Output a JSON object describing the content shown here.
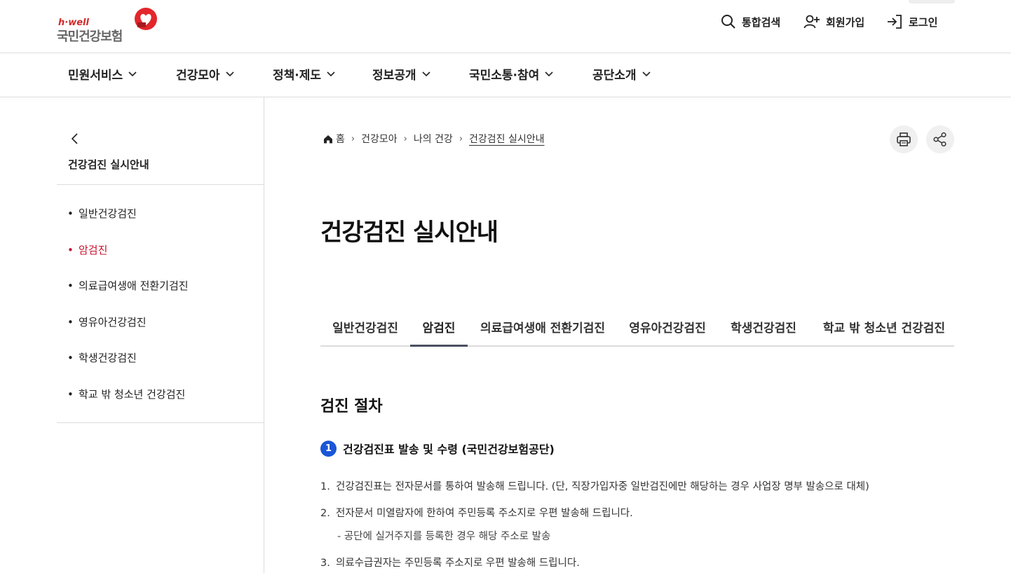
{
  "header": {
    "logo_top": "h·well",
    "logo_name": "국민건강보험",
    "utils": {
      "search": "통합검색",
      "join": "회원가입",
      "login": "로그인"
    }
  },
  "gnb": [
    "민원서비스",
    "건강모아",
    "정책·제도",
    "정보공개",
    "국민소통·참여",
    "공단소개"
  ],
  "lnb": {
    "title": "건강검진 실시안내",
    "items": [
      "일반건강검진",
      "암검진",
      "의료급여생애 전환기검진",
      "영유아건강검진",
      "학생건강검진",
      "학교 밖 청소년 건강검진"
    ],
    "active_index": 1
  },
  "breadcrumb": [
    "홈",
    "건강모아",
    "나의 건강",
    "건강검진 실시안내"
  ],
  "page_title": "건강검진 실시안내",
  "tabs": [
    "일반건강검진",
    "암검진",
    "의료급여생애 전환기검진",
    "영유아건강검진",
    "학생건강검진",
    "학교 밖 청소년 건강검진"
  ],
  "active_tab": 1,
  "section": {
    "title": "검진 절차",
    "step_number": "1",
    "step_title": "건강검진표 발송 및 수령 (국민건강보험공단)",
    "items": [
      {
        "num": "1.",
        "text": "건강검진표는 전자문서를 통하여 발송해 드립니다. (단, 직장가입자중 일반검진에만 해당하는 경우 사업장 명부 발송으로 대체)"
      },
      {
        "num": "2.",
        "text": "전자문서 미열람자에 한하여 주민등록 주소지로 우편 발송해 드립니다."
      },
      {
        "num": "3.",
        "text": "의료수급권자는 주민등록 주소지로 우편 발송해 드립니다."
      }
    ],
    "sub_item": "- 공단에 실거주지를 등록한 경우 해당 주소로 발송"
  },
  "colors": {
    "brand_red": "#c8102e",
    "step_blue": "#1a56d6"
  }
}
